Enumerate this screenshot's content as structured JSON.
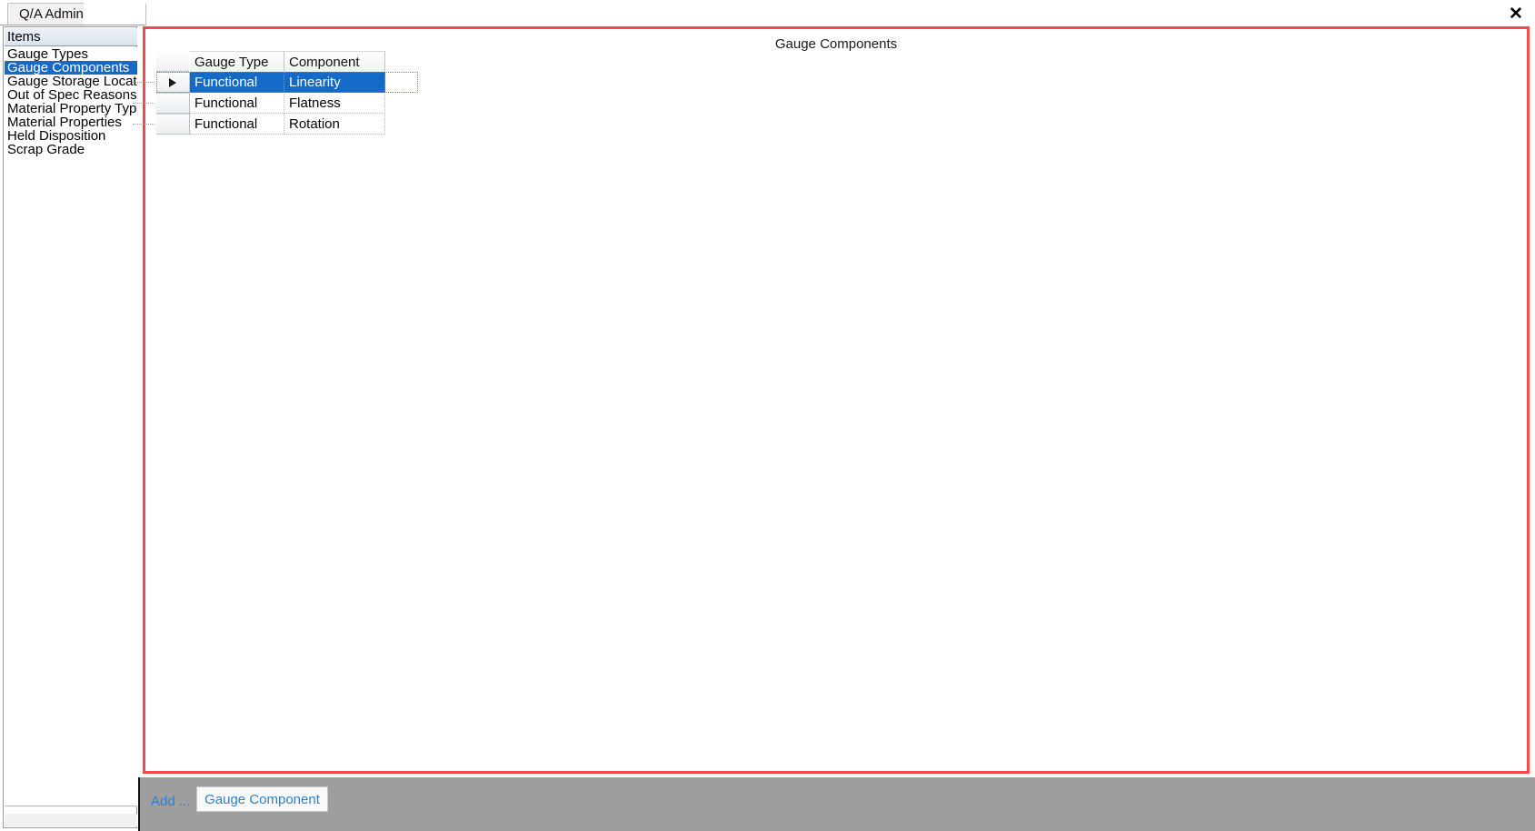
{
  "window": {
    "close_label": "✕"
  },
  "tabs": [
    {
      "label": "Q/A Admin",
      "active": true
    }
  ],
  "sidebar": {
    "header": "Items",
    "items": [
      {
        "label": "Gauge Types",
        "selected": false
      },
      {
        "label": "Gauge Components",
        "selected": true
      },
      {
        "label": "Gauge Storage Locations",
        "selected": false
      },
      {
        "label": "Out of Spec Reasons",
        "selected": false
      },
      {
        "label": "Material Property Types",
        "selected": false
      },
      {
        "label": "Material Properties",
        "selected": false
      },
      {
        "label": "Held Disposition",
        "selected": false
      },
      {
        "label": "Scrap Grade",
        "selected": false
      }
    ]
  },
  "main": {
    "title": "Gauge Components",
    "grid": {
      "columns": [
        "Gauge Type",
        "Component"
      ],
      "rows": [
        {
          "cells": [
            "Functional",
            "Linearity"
          ],
          "selected": true,
          "indicator": "▶"
        },
        {
          "cells": [
            "Functional",
            "Flatness"
          ],
          "selected": false,
          "indicator": ""
        },
        {
          "cells": [
            "Functional",
            "Rotation"
          ],
          "selected": false,
          "indicator": ""
        }
      ]
    }
  },
  "bottom_bar": {
    "add_label": "Add ...",
    "add_button_label": "Gauge Component"
  },
  "colors": {
    "panel_border_red": "#f4484a",
    "selection_blue": "#1569c7",
    "link_blue": "#2f7fd1",
    "toolbar_gray": "#9e9e9e"
  }
}
